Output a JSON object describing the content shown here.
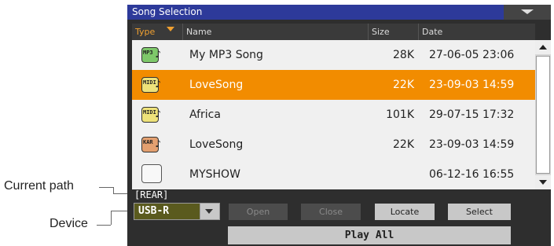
{
  "callouts": {
    "current_path": "Current path",
    "device": "Device"
  },
  "window": {
    "title": "Song Selection"
  },
  "columns": {
    "type": "Type",
    "name": "Name",
    "size": "Size",
    "date": "Date"
  },
  "files": [
    {
      "icon_label": "MP3",
      "icon": "mp3-file-icon",
      "name": "My MP3 Song",
      "size": "28K",
      "date": "27-06-05 23:06",
      "selected": false
    },
    {
      "icon_label": "MIDI",
      "icon": "midi-file-icon",
      "name": "LoveSong",
      "size": "22K",
      "date": "23-09-03 14:59",
      "selected": true
    },
    {
      "icon_label": "MIDI",
      "icon": "midi-file-icon",
      "name": "Africa",
      "size": "101K",
      "date": "29-07-15 17:32",
      "selected": false
    },
    {
      "icon_label": "KAR",
      "icon": "kar-file-icon",
      "name": "LoveSong",
      "size": "22K",
      "date": "23-09-03 14:59",
      "selected": false
    },
    {
      "icon_label": "",
      "icon": "folder-icon",
      "name": "MYSHOW",
      "size": "",
      "date": "06-12-16 16:55",
      "selected": false
    }
  ],
  "path": "[REAR]",
  "device": {
    "selected": "USB-R"
  },
  "buttons": {
    "open": "Open",
    "close": "Close",
    "locate": "Locate",
    "select": "Select",
    "play_all": "Play All"
  },
  "colors": {
    "title_bar": "#2d3a9a",
    "selection": "#f28c00",
    "type_header_accent": "#f0a030"
  }
}
